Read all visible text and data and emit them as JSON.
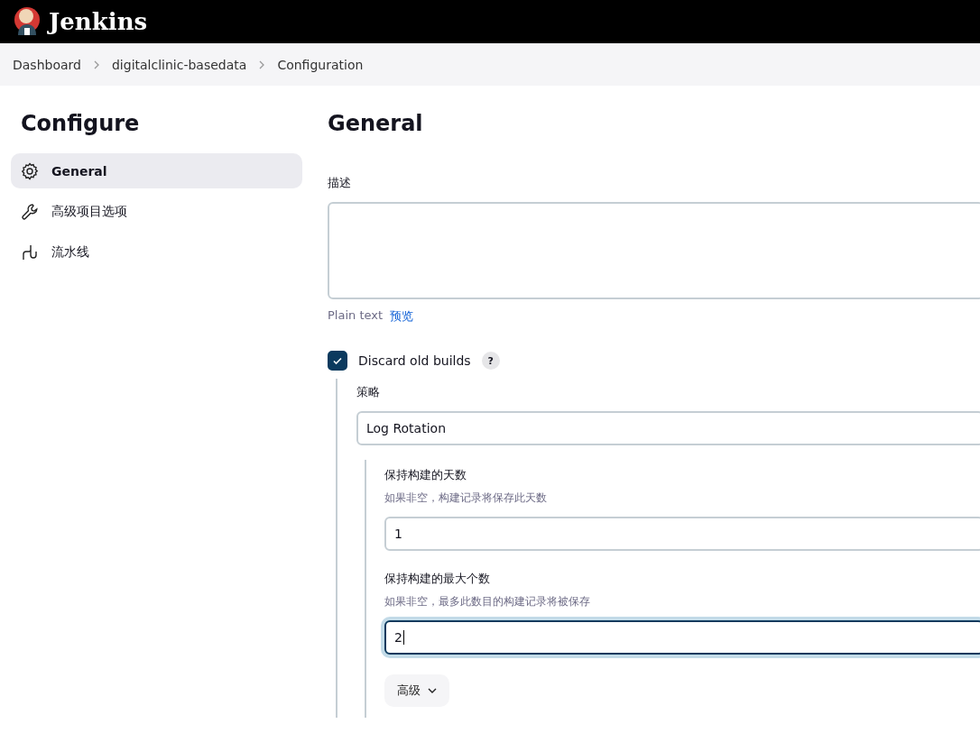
{
  "header": {
    "title": "Jenkins"
  },
  "breadcrumbs": [
    "Dashboard",
    "digitalclinic-basedata",
    "Configuration"
  ],
  "sidebar": {
    "title": "Configure",
    "items": [
      {
        "label": "General",
        "kind": "gear",
        "selected": true
      },
      {
        "label": "高级项目选项",
        "kind": "wrench",
        "selected": false
      },
      {
        "label": "流水线",
        "kind": "pipeline",
        "selected": false
      }
    ]
  },
  "main": {
    "title": "General",
    "description": {
      "label": "描述",
      "format": "Plain text",
      "preview_link": "预览"
    },
    "discard_old_builds": {
      "label": "Discard old builds",
      "checked": true,
      "help": "?",
      "strategy": {
        "label": "策略",
        "value": "Log Rotation"
      },
      "fields": [
        {
          "label": "保持构建的天数",
          "hint": "如果非空，构建记录将保存此天数",
          "value": "1",
          "focused": false
        },
        {
          "label": "保持构建的最大个数",
          "hint": "如果非空，最多此数目的构建记录将被保存",
          "value": "2",
          "focused": true
        }
      ],
      "advanced_button": "高级"
    }
  }
}
